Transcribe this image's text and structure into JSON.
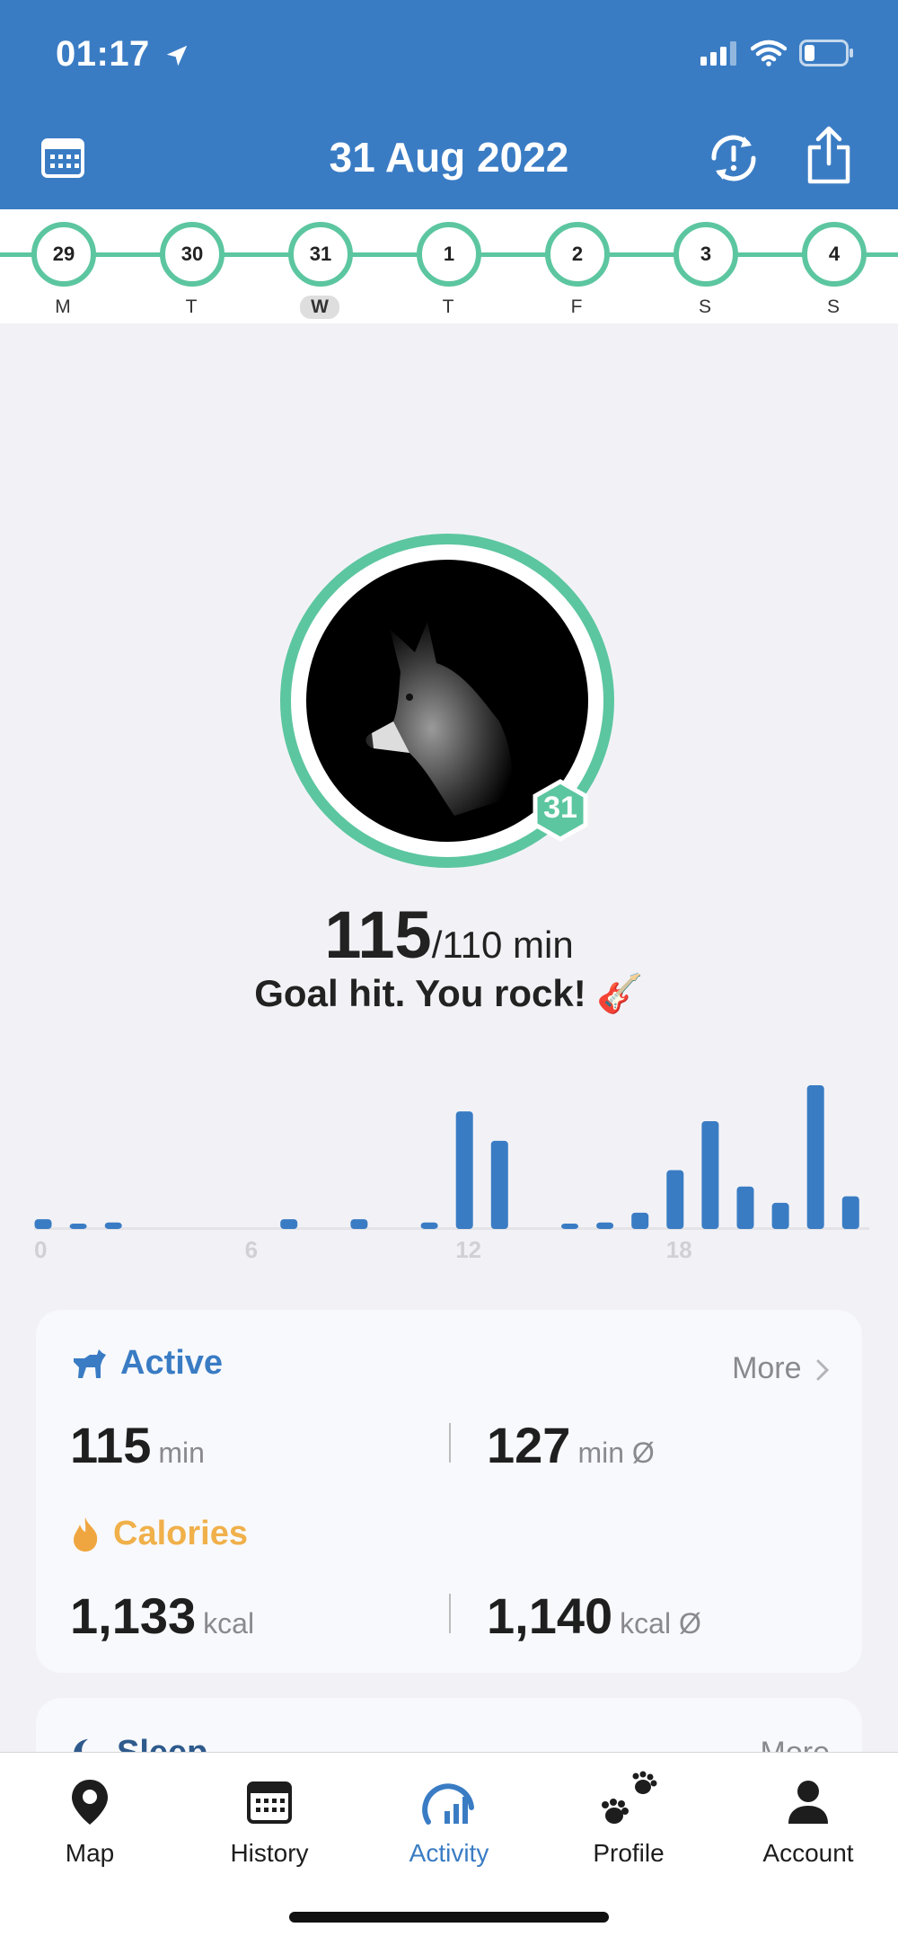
{
  "status_bar": {
    "time": "01:17"
  },
  "header": {
    "title": "31 Aug 2022"
  },
  "week": [
    {
      "num": "29",
      "letter": "M",
      "selected": false
    },
    {
      "num": "30",
      "letter": "T",
      "selected": false
    },
    {
      "num": "31",
      "letter": "W",
      "selected": true
    },
    {
      "num": "1",
      "letter": "T",
      "selected": false
    },
    {
      "num": "2",
      "letter": "F",
      "selected": false
    },
    {
      "num": "3",
      "letter": "S",
      "selected": false
    },
    {
      "num": "4",
      "letter": "S",
      "selected": false
    }
  ],
  "avatar": {
    "badge": "31"
  },
  "summary": {
    "value": "115",
    "goal": "/110 min",
    "message": "Goal hit. You rock! 🎸"
  },
  "chart_data": {
    "type": "bar",
    "x": [
      0,
      1,
      2,
      3,
      4,
      5,
      6,
      7,
      8,
      9,
      10,
      11,
      12,
      13,
      14,
      15,
      16,
      17,
      18,
      19,
      20,
      21,
      22,
      23
    ],
    "values": [
      3,
      1,
      2,
      0,
      0,
      0,
      0,
      3,
      0,
      3,
      0,
      2,
      36,
      27,
      0,
      1,
      2,
      5,
      18,
      33,
      13,
      8,
      44,
      10
    ],
    "xticks": [
      "0",
      "6",
      "12",
      "18"
    ],
    "color": "#3a7cc4"
  },
  "active": {
    "title": "Active",
    "more": "More",
    "value": "115",
    "unit": "min",
    "avg_value": "127",
    "avg_unit": "min Ø",
    "color": "#3a7cc4"
  },
  "calories": {
    "title": "Calories",
    "value": "1,133",
    "unit": "kcal",
    "avg_value": "1,140",
    "avg_unit": "kcal Ø",
    "color": "#f0b04a"
  },
  "sleep": {
    "title": "Sleep",
    "more": "More"
  },
  "tabs": [
    {
      "label": "Map",
      "icon": "map-pin-icon",
      "active": false
    },
    {
      "label": "History",
      "icon": "calendar-icon",
      "active": false
    },
    {
      "label": "Activity",
      "icon": "activity-gauge-icon",
      "active": true
    },
    {
      "label": "Profile",
      "icon": "paw-icon",
      "active": false
    },
    {
      "label": "Account",
      "icon": "person-icon",
      "active": false
    }
  ],
  "colors": {
    "header": "#3a7cc4",
    "accent_green": "#5cc6a0"
  }
}
